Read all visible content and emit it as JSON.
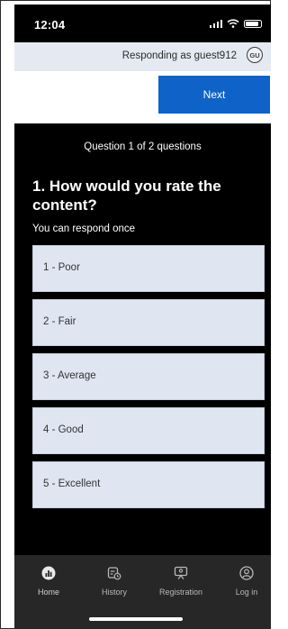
{
  "status_bar": {
    "time": "12:04"
  },
  "respondent": {
    "label": "Responding as guest912",
    "avatar_initials": "GU"
  },
  "next_button": {
    "label": "Next"
  },
  "question": {
    "counter": "Question 1 of 2 questions",
    "title": "1. How would you rate the content?",
    "subtitle": "You can respond once",
    "options": [
      {
        "label": "1 - Poor"
      },
      {
        "label": "2 - Fair"
      },
      {
        "label": "3 - Average"
      },
      {
        "label": "4 - Good"
      },
      {
        "label": "5 - Excellent"
      }
    ]
  },
  "tab_bar": {
    "items": [
      {
        "label": "Home",
        "icon": "home-icon"
      },
      {
        "label": "History",
        "icon": "history-icon"
      },
      {
        "label": "Registration",
        "icon": "registration-icon"
      },
      {
        "label": "Log in",
        "icon": "login-icon"
      }
    ]
  },
  "colors": {
    "accent": "#0f62c8",
    "option_bg": "#dfe6f2",
    "respond_bar_bg": "#e4e9f2",
    "tab_bar_bg": "#272727"
  }
}
